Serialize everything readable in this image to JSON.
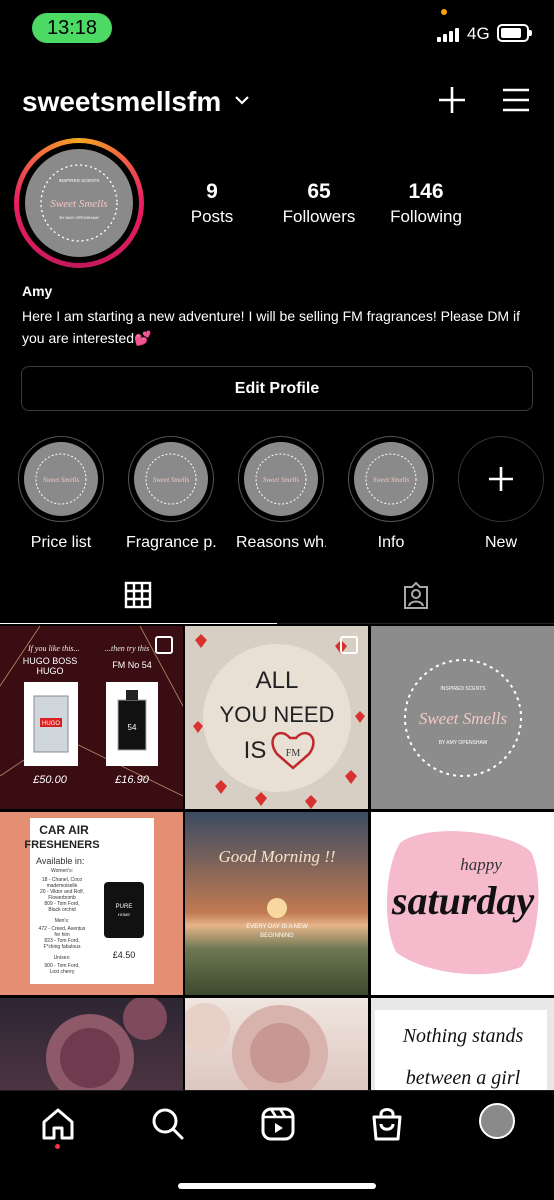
{
  "status_bar": {
    "time": "13:18",
    "network": "4G"
  },
  "header": {
    "username": "sweetsmellsfm"
  },
  "profile": {
    "avatar_text": "Sweet Smells",
    "avatar_top_text": "INSPIRED SCENTS",
    "avatar_bottom_text": "BY AMY OPENSHAW",
    "stats": [
      {
        "value": "9",
        "label": "Posts"
      },
      {
        "value": "65",
        "label": "Followers"
      },
      {
        "value": "146",
        "label": "Following"
      }
    ],
    "display_name": "Amy",
    "bio": "Here I am starting a new adventure! I will be selling FM fragrances! Please DM if you are interested",
    "bio_emoji": "💕",
    "edit_label": "Edit Profile"
  },
  "highlights": [
    {
      "label": "Price list"
    },
    {
      "label": "Fragrance p..."
    },
    {
      "label": "Reasons wh..."
    },
    {
      "label": "Info"
    },
    {
      "label": "New"
    }
  ],
  "posts": {
    "p1": {
      "left_head": "If you like this...",
      "right_head": "...then try this",
      "left_brand": "HUGO BOSS",
      "left_name": "HUGO",
      "right_name": "FM No 54",
      "bottle_left": "HUGO",
      "bottle_right": "54",
      "left_price": "£50.00",
      "right_price": "£16.90"
    },
    "p2": {
      "line1": "ALL",
      "line2": "YOU NEED",
      "line3": "IS",
      "badge": "FM"
    },
    "p3": {
      "top": "INSPIRED SCENTS",
      "title": "Sweet Smells",
      "bottom": "BY AMY OPENSHAW"
    },
    "p4": {
      "title1": "CAR AIR",
      "title2": "FRESHENERS",
      "available": "Available in:",
      "womens": "Women's:",
      "w1": "18 - Chanel, Coco",
      "w2": "mademoiselle",
      "w3": "20 - Viktor and Rolf,",
      "w4": "Flowerbomb",
      "w5": "809 - Tom Ford,",
      "w6": "Black orchid",
      "mens": "Men's:",
      "m1": "472 - Creed, Aventus",
      "m2": "for him",
      "m3": "823 - Tom Ford,",
      "m4": "F*cking fabulous",
      "unisex": "Unisex:",
      "u1": "900 - Tom Ford,",
      "u2": "Lost cherry",
      "pure": "PURE",
      "home": "HOME",
      "price": "£4.50"
    },
    "p5": {
      "title": "Good Morning !!",
      "line1": "EVERY DAY IS A NEW",
      "line2": "BEGINNING"
    },
    "p6": {
      "small": "happy",
      "big": "saturday"
    },
    "p9": {
      "line1": "Nothing stands",
      "line2": "between a girl"
    }
  },
  "colors": {
    "accent_green": "#4cd964",
    "notification": "#ff3040"
  }
}
